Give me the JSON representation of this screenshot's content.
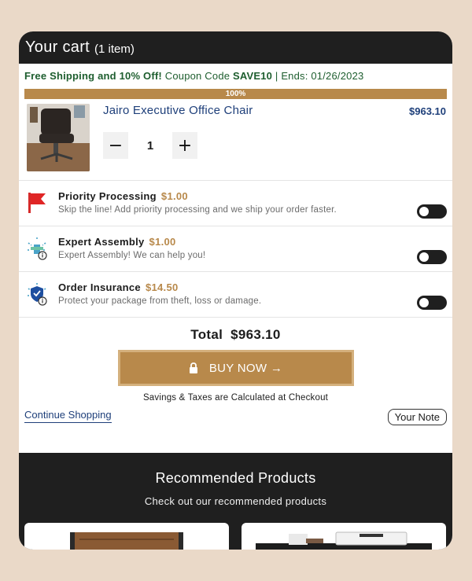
{
  "header": {
    "title": "Your cart",
    "count": "(1 item)"
  },
  "promo": {
    "prefix": "Free Shipping and 10% Off!",
    "coupon_label": "Coupon Code",
    "code": "SAVE10",
    "separator": "|",
    "ends": "Ends: 01/26/2023"
  },
  "progress": {
    "label": "100%",
    "fraction": 1.0
  },
  "product": {
    "name": "Jairo Executive Office Chair",
    "price": "$963.10",
    "quantity": "1",
    "minus": "−",
    "plus": "+"
  },
  "addons": [
    {
      "title": "Priority Processing",
      "price": "$1.00",
      "desc": "Skip the line! Add priority processing and we ship your order faster.",
      "icon": "flag-icon",
      "enabled": false
    },
    {
      "title": "Expert Assembly",
      "price": "$1.00",
      "desc": "Expert Assembly! We can help you!",
      "icon": "assembly-icon",
      "enabled": false
    },
    {
      "title": "Order Insurance",
      "price": "$14.50",
      "desc": "Protect your package from theft, loss or damage.",
      "icon": "shield-icon",
      "enabled": false
    }
  ],
  "total": {
    "label": "Total",
    "value": "$963.10"
  },
  "buy": {
    "label": "BUY NOW →"
  },
  "checkout_note": "Savings & Taxes are Calculated at Checkout",
  "links": {
    "continue": "Continue Shopping",
    "note": "Your Note"
  },
  "recommended": {
    "title": "Recommended Products",
    "subtitle": "Check out our recommended products"
  },
  "colors": {
    "accent": "#b8894b",
    "dark": "#1f1f1f",
    "link": "#1e3f7a",
    "promo": "#1e5e2f",
    "background": "#ead9c8"
  }
}
